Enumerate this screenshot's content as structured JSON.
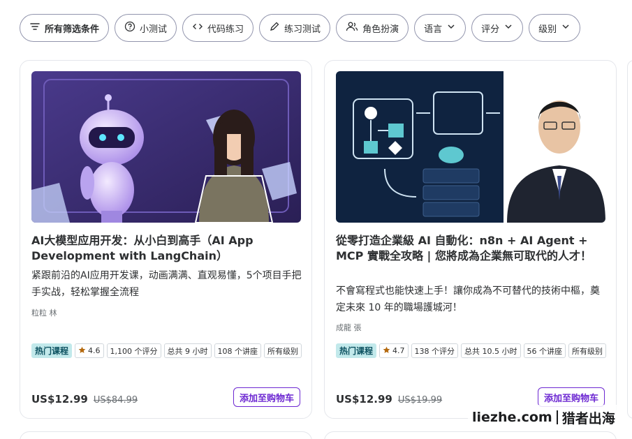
{
  "filters": [
    {
      "label": "所有筛选条件",
      "icon": "filter-icon"
    },
    {
      "label": "小测试",
      "icon": "question-circle-icon"
    },
    {
      "label": "代码练习",
      "icon": "code-icon"
    },
    {
      "label": "练习测试",
      "icon": "pencil-icon"
    },
    {
      "label": "角色扮演",
      "icon": "users-icon"
    },
    {
      "label": "语言",
      "icon": "chevron-down-icon"
    },
    {
      "label": "评分",
      "icon": "chevron-down-icon"
    },
    {
      "label": "级别",
      "icon": "chevron-down-icon"
    }
  ],
  "courses": [
    {
      "title": "AI大模型应用开发：从小白到高手（AI App Development with LangChain）",
      "description": "紧跟前沿的AI应用开发课，动画满满、直观易懂，5个项目手把手实战，轻松掌握全流程",
      "author": "粒粒 林",
      "badge": "热门课程",
      "rating": "4.6",
      "ratings_count": "1,100 个评分",
      "hours": "总共 9 小时",
      "lectures": "108 个讲座",
      "level": "所有级别",
      "price": "US$12.99",
      "original_price": "US$84.99",
      "cart_label": "添加至购物车",
      "image_colors": {
        "bg": "#3b2a6e",
        "accent": "#a78bfa"
      }
    },
    {
      "title": "從零打造企業級 AI 自動化：n8n + AI Agent + MCP 實戰全攻略 | 您將成為企業無可取代的人才！",
      "description": "不會寫程式也能快速上手！讓你成為不可替代的技術中樞，奠定未來 10 年的職場護城河！",
      "author": "成龍 張",
      "badge": "热门课程",
      "rating": "4.7",
      "ratings_count": "138 个评分",
      "hours": "总共 10.5 小时",
      "lectures": "56 个讲座",
      "level": "所有级别",
      "price": "US$12.99",
      "original_price": "US$19.99",
      "cart_label": "添加至购物车",
      "image_colors": {
        "bg": "#0f2340",
        "accent": "#5ec8d0"
      }
    }
  ],
  "watermark": {
    "site": "liezhe.com",
    "name": "猎者出海"
  },
  "colors": {
    "accent": "#6d28d2",
    "badge_bg": "#c2e9eb",
    "star": "#b4690e"
  }
}
